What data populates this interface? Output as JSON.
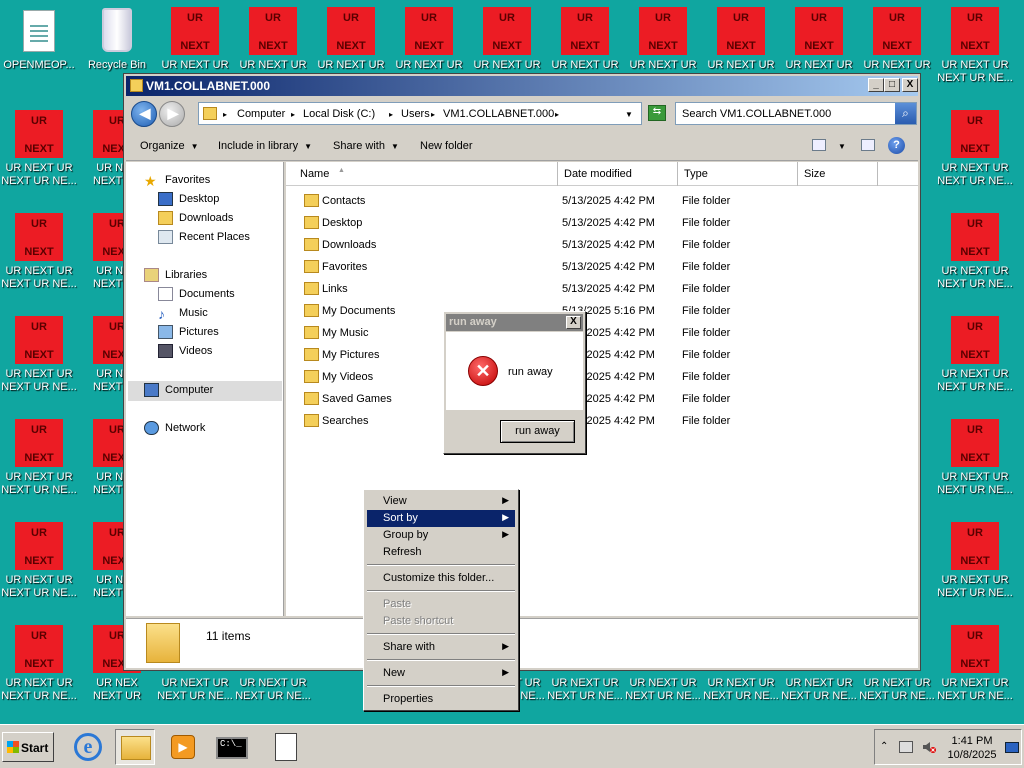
{
  "desktop": {
    "openmeop_label": "OPENMEOP...",
    "recycle_label": "Recycle Bin",
    "ur_top": "UR",
    "ur_bottom": "NEXT",
    "ur_label_line1": "UR NEXT UR",
    "ur_label_line2": "NEXT UR NE...",
    "ur_label_partial1": "UR NEX",
    "ur_label_partial2": "NEXT UR",
    "ur_label_bottomrow": "UR NEXT UR",
    "ur_label_bottomrow2": "NEXT UR NE..."
  },
  "window": {
    "title": "VM1.COLLABNET.000",
    "min_btn": "_",
    "max_btn": "□",
    "close_btn": "X",
    "breadcrumb": [
      "Computer",
      "Local Disk (C:)",
      "Users",
      "VM1.COLLABNET.000"
    ],
    "search_placeholder": "Search VM1.COLLABNET.000",
    "toolbar": {
      "organize": "Organize",
      "include": "Include in library",
      "share": "Share with",
      "newfolder": "New folder"
    },
    "nav": {
      "favorites": "Favorites",
      "desktop": "Desktop",
      "downloads": "Downloads",
      "recent": "Recent Places",
      "libraries": "Libraries",
      "documents": "Documents",
      "music": "Music",
      "pictures": "Pictures",
      "videos": "Videos",
      "computer": "Computer",
      "network": "Network"
    },
    "columns": {
      "name": "Name",
      "date": "Date modified",
      "type": "Type",
      "size": "Size"
    },
    "files": [
      {
        "name": "Contacts",
        "date": "5/13/2025 4:42 PM",
        "type": "File folder"
      },
      {
        "name": "Desktop",
        "date": "5/13/2025 4:42 PM",
        "type": "File folder"
      },
      {
        "name": "Downloads",
        "date": "5/13/2025 4:42 PM",
        "type": "File folder"
      },
      {
        "name": "Favorites",
        "date": "5/13/2025 4:42 PM",
        "type": "File folder"
      },
      {
        "name": "Links",
        "date": "5/13/2025 4:42 PM",
        "type": "File folder"
      },
      {
        "name": "My Documents",
        "date": "5/13/2025 5:16 PM",
        "type": "File folder"
      },
      {
        "name": "My Music",
        "date": "5/13/2025 4:42 PM",
        "type": "File folder"
      },
      {
        "name": "My Pictures",
        "date": "5/13/2025 4:42 PM",
        "type": "File folder"
      },
      {
        "name": "My Videos",
        "date": "5/13/2025 4:42 PM",
        "type": "File folder"
      },
      {
        "name": "Saved Games",
        "date": "5/13/2025 4:42 PM",
        "type": "File folder"
      },
      {
        "name": "Searches",
        "date": "5/13/2025 4:42 PM",
        "type": "File folder"
      }
    ],
    "item_count": "11 items"
  },
  "dialog": {
    "title": "run away",
    "message": "run away",
    "button": "run away",
    "close": "X"
  },
  "context_menu": {
    "view": "View",
    "sortby": "Sort by",
    "groupby": "Group by",
    "refresh": "Refresh",
    "customize": "Customize this folder...",
    "paste": "Paste",
    "paste_shortcut": "Paste shortcut",
    "sharewith": "Share with",
    "new": "New",
    "properties": "Properties",
    "arrow": "▶"
  },
  "taskbar": {
    "start": "Start",
    "time": "1:41 PM",
    "date": "10/8/2025",
    "cmd_text": "C:\\_"
  },
  "colors": {
    "desktop_bg": "#10a6a0",
    "ur_red": "#ec1c24",
    "menu_highlight": "#0a246a"
  }
}
